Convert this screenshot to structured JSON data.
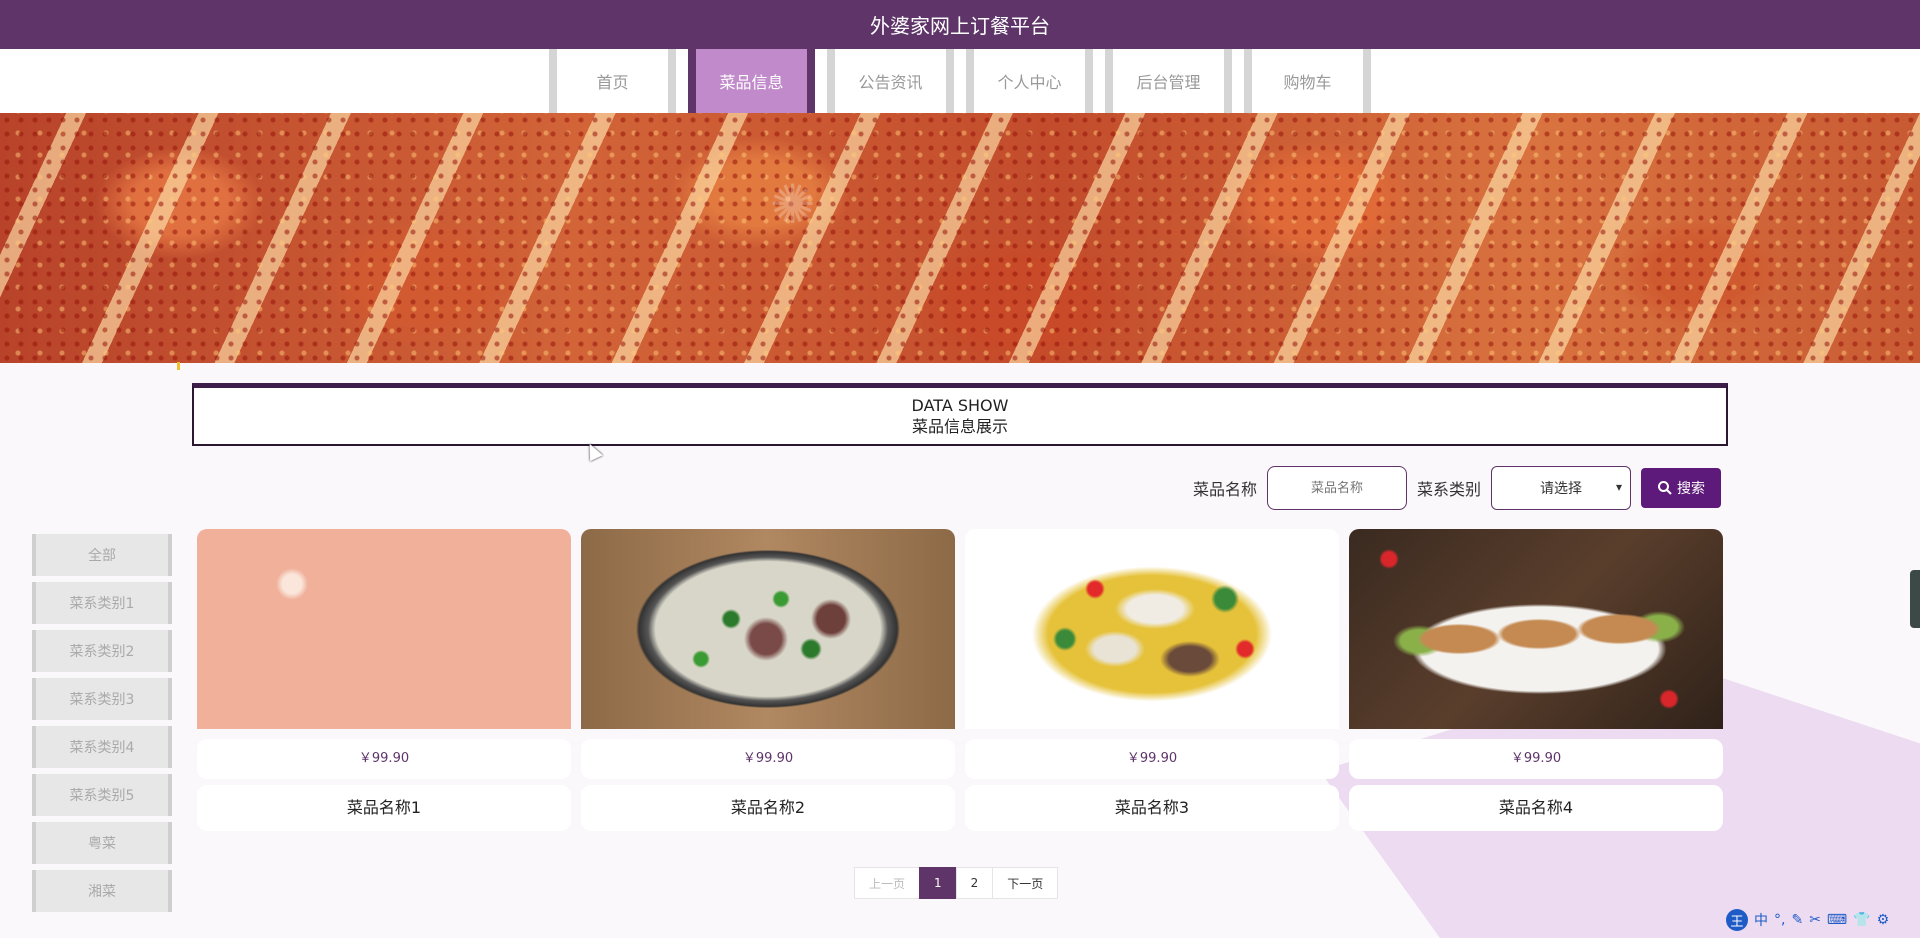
{
  "header": {
    "title": "外婆家网上订餐平台"
  },
  "nav": {
    "items": [
      {
        "label": "首页",
        "active": false
      },
      {
        "label": "菜品信息",
        "active": true
      },
      {
        "label": "公告资讯",
        "active": false
      },
      {
        "label": "个人中心",
        "active": false
      },
      {
        "label": "后台管理",
        "active": false
      },
      {
        "label": "购物车",
        "active": false
      }
    ]
  },
  "section": {
    "title_en": "DATA SHOW",
    "title_cn": "菜品信息展示"
  },
  "search": {
    "name_label": "菜品名称",
    "name_placeholder": "菜品名称",
    "category_label": "菜系类别",
    "category_selected": "请选择",
    "button_label": "搜索"
  },
  "sidebar": {
    "items": [
      "全部",
      "菜系类别1",
      "菜系类别2",
      "菜系类别3",
      "菜系类别4",
      "菜系类别5",
      "粤菜",
      "湘菜"
    ]
  },
  "products": [
    {
      "price": "￥99.90",
      "name": "菜品名称1"
    },
    {
      "price": "￥99.90",
      "name": "菜品名称2"
    },
    {
      "price": "￥99.90",
      "name": "菜品名称3"
    },
    {
      "price": "￥99.90",
      "name": "菜品名称4"
    }
  ],
  "pagination": {
    "prev": "上一页",
    "pages": [
      "1",
      "2"
    ],
    "current": "1",
    "next": "下一页"
  },
  "ime": {
    "logo": "王",
    "mode": "中"
  },
  "colors": {
    "primary": "#5e3469",
    "active_nav": "#c18bcb",
    "search_button": "#5e1a7a",
    "decoration": "#ead6ee"
  }
}
